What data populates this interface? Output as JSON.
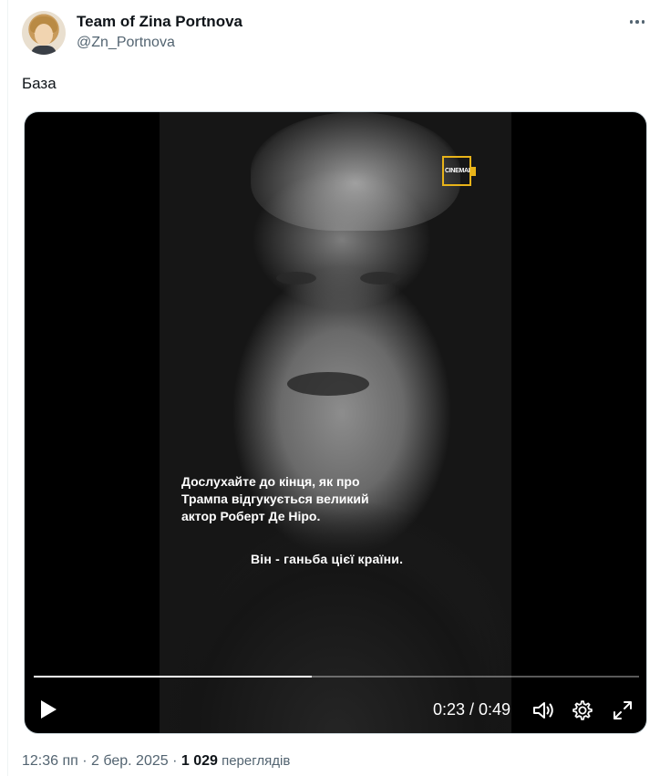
{
  "tweet": {
    "author_name": "Team of Zina Portnova",
    "author_handle": "@Zn_Portnova",
    "text": "База",
    "timestamp": "12:36 пп · 2 бер. 2025 · ",
    "views_count": "1 029",
    "views_label": " переглядів"
  },
  "video": {
    "watermark": "CINEMAIS",
    "subtitle_intro": "Дослухайте до кінця, як про Трампа відгукується великий актор Роберт Де Ніро.",
    "subtitle_line": "Він - ганьба цієї країни.",
    "current_time": "0:23",
    "duration": "0:49",
    "time_display": "0:23 / 0:49",
    "progress_fraction": 0.46
  },
  "icons": {
    "more": "more-horizontal-icon",
    "play": "play-icon",
    "volume": "volume-icon",
    "settings": "gear-icon",
    "fullscreen": "fullscreen-icon"
  },
  "colors": {
    "text_primary": "#0f1419",
    "text_secondary": "#536471",
    "watermark_accent": "#e8b319"
  }
}
